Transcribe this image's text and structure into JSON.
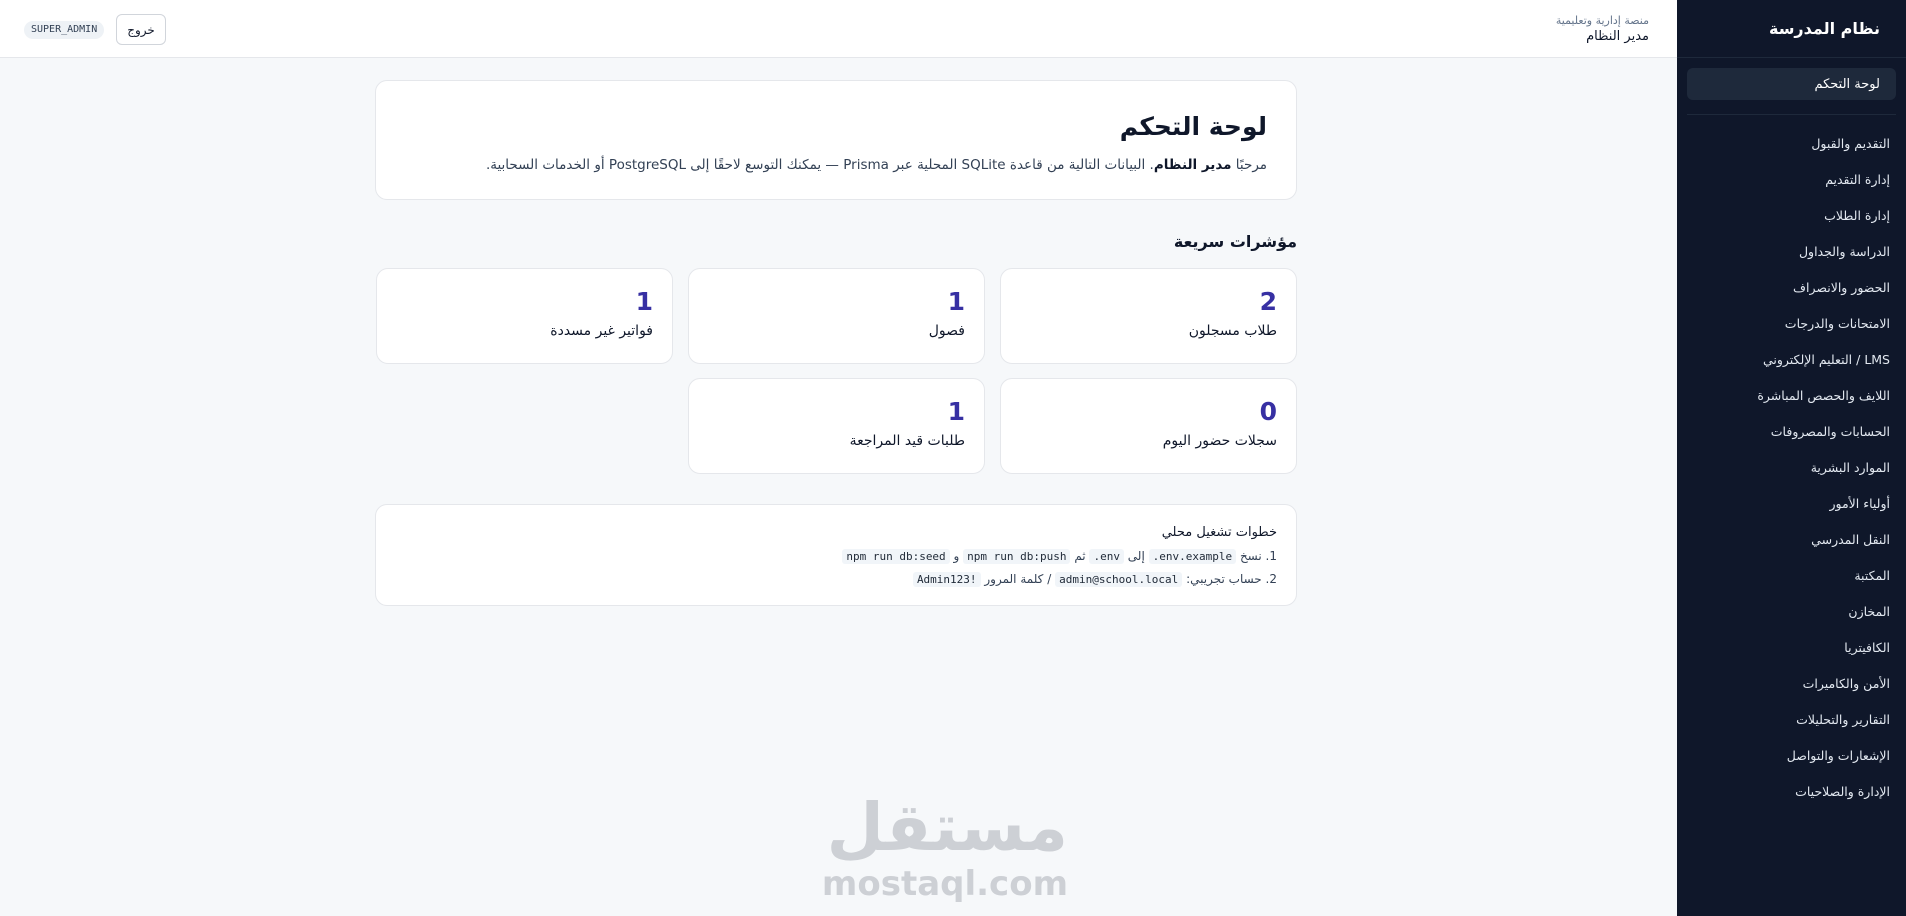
{
  "sidebar": {
    "title": "نظام المدرسة",
    "active_item": "لوحة التحكم",
    "items": [
      "التقديم والقبول",
      "إدارة التقديم",
      "إدارة الطلاب",
      "الدراسة والجداول",
      "الحضور والانصراف",
      "الامتحانات والدرجات",
      "LMS / التعليم الإلكتروني",
      "اللايف والحصص المباشرة",
      "الحسابات والمصروفات",
      "الموارد البشرية",
      "أولياء الأمور",
      "النقل المدرسي",
      "المكتبة",
      "المخازن",
      "الكافيتريا",
      "الأمن والكاميرات",
      "التقارير والتحليلات",
      "الإشعارات والتواصل",
      "الإدارة والصلاحيات"
    ]
  },
  "topbar": {
    "platform_subtitle": "منصة إدارية وتعليمية",
    "user_role": "مدير النظام",
    "role_badge": "SUPER_ADMIN",
    "logout_label": "خروج"
  },
  "intro": {
    "title": "لوحة التحكم",
    "welcome_prefix": "مرحبًا",
    "welcome_name": "مدير النظام",
    "welcome_text": ". البيانات التالية من قاعدة SQLite المحلية عبر Prisma — يمكنك التوسع لاحقًا إلى PostgreSQL أو الخدمات السحابية."
  },
  "quick_stats": {
    "title": "مؤشرات سريعة",
    "cards": [
      {
        "value": "2",
        "label": "طلاب مسجلون"
      },
      {
        "value": "1",
        "label": "فصول"
      },
      {
        "value": "1",
        "label": "فواتير غير مسددة"
      },
      {
        "value": "0",
        "label": "سجلات حضور اليوم"
      },
      {
        "value": "1",
        "label": "طلبات قيد المراجعة"
      }
    ]
  },
  "local_steps": {
    "title": "خطوات تشغيل محلي",
    "step1": {
      "prefix": "1. نسخ",
      "code1": ".env.example",
      "to": "إلى",
      "code2": ".env",
      "then": "ثم",
      "code3": "npm run db:push",
      "and": "و",
      "code4": "npm run db:seed"
    },
    "step2": {
      "prefix": "2. حساب تجريبي:",
      "email": "admin@school.local",
      "sep": "/ كلمة المرور",
      "password": "Admin123!"
    }
  },
  "watermark": {
    "arabic": "مستقل",
    "latin": "mostaql.com"
  }
}
